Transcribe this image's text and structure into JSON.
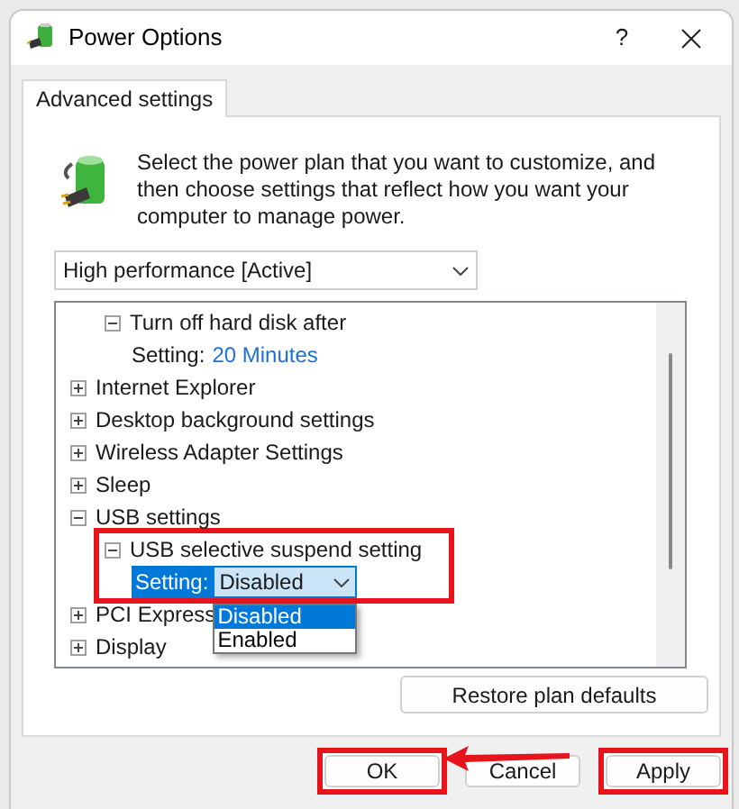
{
  "window": {
    "title": "Power Options",
    "help": "?"
  },
  "tabs": [
    {
      "label": "Advanced settings",
      "selected": true
    }
  ],
  "intro": "Select the power plan that you want to customize, and then choose settings that reflect how you want your computer to manage power.",
  "plan_select": {
    "value": "High performance [Active]"
  },
  "tree": [
    {
      "kind": "continued",
      "children": [
        {
          "kind": "group",
          "label": "Turn off hard disk after",
          "expanded": true,
          "highlighted": false,
          "children": [
            {
              "kind": "setting",
              "label": "Setting:",
              "value": "20 Minutes",
              "editing": false
            }
          ]
        }
      ]
    },
    {
      "kind": "group",
      "label": "Internet Explorer",
      "expanded": false,
      "highlighted": false
    },
    {
      "kind": "group",
      "label": "Desktop background settings",
      "expanded": false,
      "highlighted": false
    },
    {
      "kind": "group",
      "label": "Wireless Adapter Settings",
      "expanded": false,
      "highlighted": false
    },
    {
      "kind": "group",
      "label": "Sleep",
      "expanded": false,
      "highlighted": false
    },
    {
      "kind": "group",
      "label": "USB settings",
      "expanded": true,
      "highlighted": false,
      "children": [
        {
          "kind": "group",
          "label": "USB selective suspend setting",
          "expanded": true,
          "highlighted": true,
          "children": [
            {
              "kind": "setting",
              "label": "Setting:",
              "value": "Disabled",
              "editing": true,
              "options": [
                {
                  "label": "Disabled",
                  "selected": true
                },
                {
                  "label": "Enabled",
                  "selected": false
                }
              ]
            }
          ]
        }
      ]
    },
    {
      "kind": "group",
      "label": "PCI Express",
      "expanded": false,
      "highlighted": false
    },
    {
      "kind": "group",
      "label": "Display",
      "expanded": false,
      "highlighted": false
    }
  ],
  "restore_button": "Restore plan defaults",
  "buttons": [
    {
      "label": "OK",
      "highlighted": true
    },
    {
      "label": "Cancel",
      "highlighted": false,
      "arrow_from": true
    },
    {
      "label": "Apply",
      "highlighted": true
    }
  ]
}
